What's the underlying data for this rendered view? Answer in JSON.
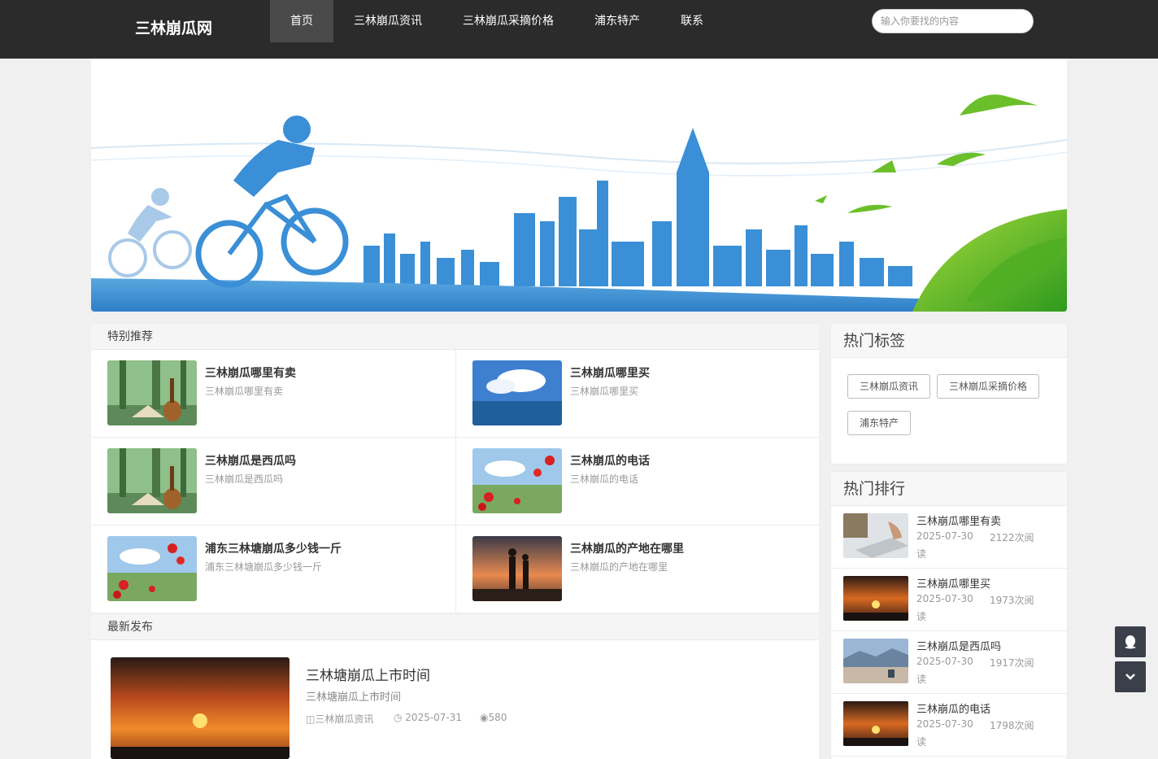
{
  "site": {
    "logo": "三林崩瓜网"
  },
  "nav": {
    "items": [
      "首页",
      "三林崩瓜资讯",
      "三林崩瓜采摘价格",
      "浦东特产",
      "联系"
    ]
  },
  "search": {
    "placeholder": "输入你要找的内容"
  },
  "featured": {
    "title": "特别推荐",
    "items": [
      {
        "title": "三林崩瓜哪里有卖",
        "sub": "三林崩瓜哪里有卖",
        "thumb": "guitar-forest"
      },
      {
        "title": "三林崩瓜哪里买",
        "sub": "三林崩瓜哪里买",
        "thumb": "sky-ocean"
      },
      {
        "title": "三林崩瓜是西瓜吗",
        "sub": "三林崩瓜是西瓜吗",
        "thumb": "guitar-forest"
      },
      {
        "title": "三林崩瓜的电话",
        "sub": "三林崩瓜的电话",
        "thumb": "poppies"
      },
      {
        "title": "浦东三林塘崩瓜多少钱一斤",
        "sub": "浦东三林塘崩瓜多少钱一斤",
        "thumb": "poppies"
      },
      {
        "title": "三林崩瓜的产地在哪里",
        "sub": "三林崩瓜的产地在哪里",
        "thumb": "couple-sunset"
      }
    ]
  },
  "latest": {
    "title": "最新发布",
    "article": {
      "title": "三林塘崩瓜上市时间",
      "sub": "三林塘崩瓜上市时间",
      "category": "三林崩瓜资讯",
      "date": "2025-07-31",
      "views": "580"
    }
  },
  "tags": {
    "title": "热门标签",
    "items": [
      "三林崩瓜资讯",
      "三林崩瓜采摘价格",
      "浦东特产"
    ]
  },
  "ranking": {
    "title": "热门排行",
    "unit": "读",
    "items": [
      {
        "title": "三林崩瓜哪里有卖",
        "date": "2025-07-30",
        "views": "2122次阅",
        "thumb": "laptop"
      },
      {
        "title": "三林崩瓜哪里买",
        "date": "2025-07-30",
        "views": "1973次阅",
        "thumb": "sunset"
      },
      {
        "title": "三林崩瓜是西瓜吗",
        "date": "2025-07-30",
        "views": "1917次阅",
        "thumb": "lake"
      },
      {
        "title": "三林崩瓜的电话",
        "date": "2025-07-30",
        "views": "1798次阅",
        "thumb": "sunset"
      }
    ]
  },
  "float": {
    "icons": [
      "qq-icon",
      "chevron-down-icon"
    ]
  },
  "colors": {
    "header": "#2b2b2b",
    "accent": "#3a8fd6",
    "leaf": "#6bbf2a"
  }
}
